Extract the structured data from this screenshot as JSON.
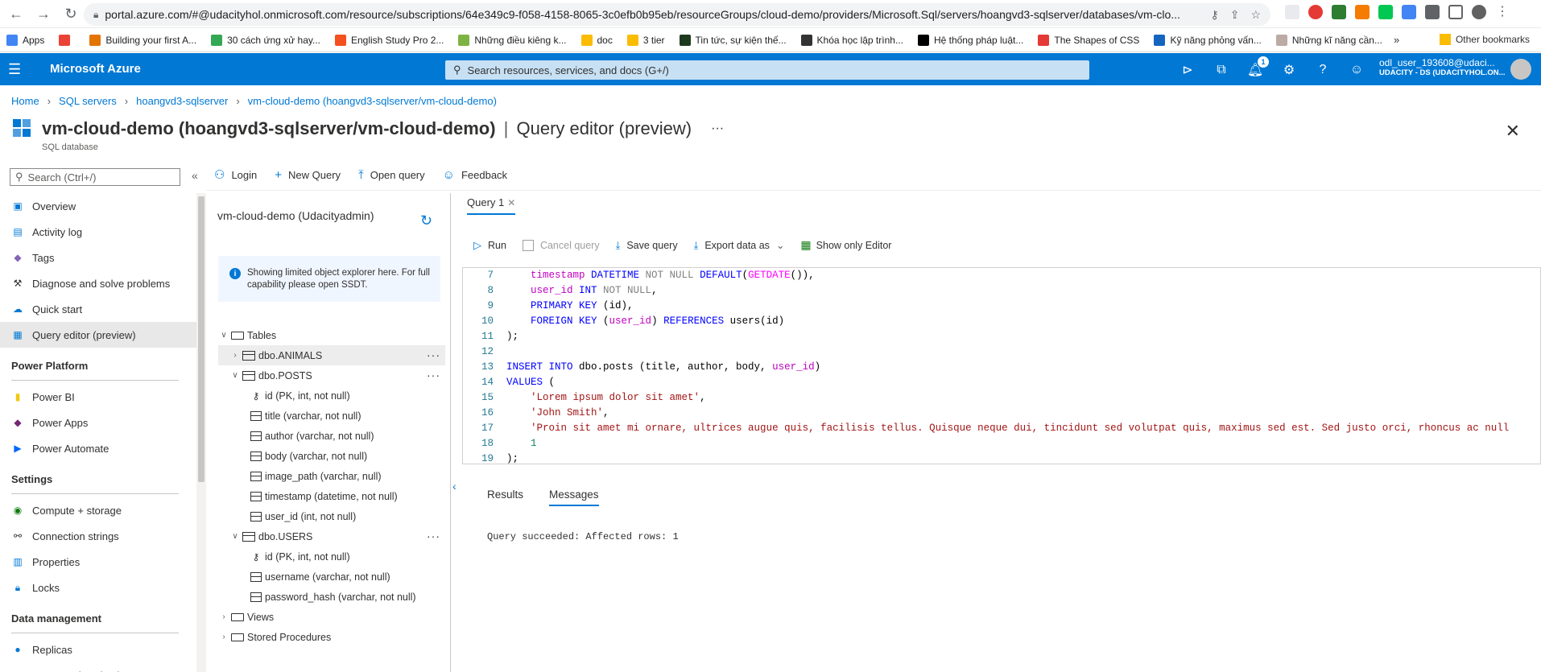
{
  "browser": {
    "url": "portal.azure.com/#@udacityhol.onmicrosoft.com/resource/subscriptions/64e349c9-f058-4158-8065-3c0efb0b95eb/resourceGroups/cloud-demo/providers/Microsoft.Sql/servers/hoangvd3-sqlserver/databases/vm-clo...",
    "bookmarks": [
      {
        "label": "Apps",
        "color": "#4285f4"
      },
      {
        "label": "",
        "color": "#ea4335"
      },
      {
        "label": "Building your first A...",
        "color": "#e37400"
      },
      {
        "label": "30 cách ứng xử hay...",
        "color": "#34a853"
      },
      {
        "label": "English Study Pro 2...",
        "color": "#f4511e"
      },
      {
        "label": "Những điều kiêng k...",
        "color": "#7cb342"
      },
      {
        "label": "doc",
        "color": "#fbbc04"
      },
      {
        "label": "3 tier",
        "color": "#fbbc04"
      },
      {
        "label": "Tin tức, sự kiện thế...",
        "color": "#1e3a1e"
      },
      {
        "label": "Khóa học lập trình...",
        "color": "#333333"
      },
      {
        "label": "Hệ thống pháp luật...",
        "color": "#000000"
      },
      {
        "label": "The Shapes of CSS",
        "color": "#e53935"
      },
      {
        "label": "Kỹ năng phỏng vấn...",
        "color": "#1565c0"
      },
      {
        "label": "Những kĩ năng cần...",
        "color": "#bcaaa4"
      }
    ],
    "more_chevron": "»",
    "other_bookmarks": "Other bookmarks"
  },
  "azure": {
    "brand": "Microsoft Azure",
    "search_placeholder": "Search resources, services, and docs (G+/)",
    "notification_count": "1",
    "user_name": "odl_user_193608@udaci...",
    "user_directory": "UDACITY - DS (UDACITYHOL.ON..."
  },
  "breadcrumb": [
    {
      "label": "Home"
    },
    {
      "label": "SQL servers"
    },
    {
      "label": "hoangvd3-sqlserver"
    },
    {
      "label": "vm-cloud-demo (hoangvd3-sqlserver/vm-cloud-demo)"
    }
  ],
  "page": {
    "title_bold": "vm-cloud-demo (hoangvd3-sqlserver/vm-cloud-demo)",
    "title_sep": "|",
    "title_rest": "Query editor (preview)",
    "subtitle": "SQL database",
    "more": "···",
    "close": "✕"
  },
  "left_nav": {
    "search_placeholder": "Search (Ctrl+/)",
    "collapse": "«",
    "items": [
      {
        "type": "item",
        "label": "Overview",
        "icon": "overview-icon",
        "color": "#0078d4"
      },
      {
        "type": "item",
        "label": "Activity log",
        "icon": "activity-log-icon",
        "color": "#0078d4"
      },
      {
        "type": "item",
        "label": "Tags",
        "icon": "tags-icon",
        "color": "#8764b8"
      },
      {
        "type": "item",
        "label": "Diagnose and solve problems",
        "icon": "wrench-icon",
        "color": "#323130"
      },
      {
        "type": "item",
        "label": "Quick start",
        "icon": "cloud-icon",
        "color": "#0078d4"
      },
      {
        "type": "item",
        "label": "Query editor (preview)",
        "icon": "query-editor-icon",
        "color": "#0078d4",
        "active": true
      },
      {
        "type": "section",
        "label": "Power Platform"
      },
      {
        "type": "item",
        "label": "Power BI",
        "icon": "power-bi-icon",
        "color": "#f2c811"
      },
      {
        "type": "item",
        "label": "Power Apps",
        "icon": "power-apps-icon",
        "color": "#742774"
      },
      {
        "type": "item",
        "label": "Power Automate",
        "icon": "power-automate-icon",
        "color": "#0066ff"
      },
      {
        "type": "section",
        "label": "Settings"
      },
      {
        "type": "item",
        "label": "Compute + storage",
        "icon": "compute-icon",
        "color": "#107c10"
      },
      {
        "type": "item",
        "label": "Connection strings",
        "icon": "connection-icon",
        "color": "#323130"
      },
      {
        "type": "item",
        "label": "Properties",
        "icon": "properties-icon",
        "color": "#0078d4"
      },
      {
        "type": "item",
        "label": "Locks",
        "icon": "lock-icon",
        "color": "#0078d4"
      },
      {
        "type": "section",
        "label": "Data management"
      },
      {
        "type": "item",
        "label": "Replicas",
        "icon": "replicas-icon",
        "color": "#0078d4"
      },
      {
        "type": "item",
        "label": "Sync to other databases",
        "icon": "sync-icon",
        "color": "#0078d4"
      }
    ]
  },
  "toolbar": {
    "login": "Login",
    "new_query": "New Query",
    "open_query": "Open query",
    "feedback": "Feedback"
  },
  "explorer": {
    "title": "vm-cloud-demo (Udacityadmin)",
    "info": "Showing limited object explorer here. For full capability please open SSDT.",
    "tree": [
      {
        "level": 0,
        "chev": "∨",
        "icon": "folder",
        "label": "Tables"
      },
      {
        "level": 1,
        "chev": "›",
        "icon": "table",
        "label": "dbo.ANIMALS",
        "dots": true,
        "hl": true
      },
      {
        "level": 1,
        "chev": "∨",
        "icon": "table",
        "label": "dbo.POSTS",
        "dots": true
      },
      {
        "level": 2,
        "chev": "",
        "icon": "key",
        "label": "id (PK, int, not null)"
      },
      {
        "level": 2,
        "chev": "",
        "icon": "col",
        "label": "title (varchar, not null)"
      },
      {
        "level": 2,
        "chev": "",
        "icon": "col",
        "label": "author (varchar, not null)"
      },
      {
        "level": 2,
        "chev": "",
        "icon": "col",
        "label": "body (varchar, not null)"
      },
      {
        "level": 2,
        "chev": "",
        "icon": "col",
        "label": "image_path (varchar, null)"
      },
      {
        "level": 2,
        "chev": "",
        "icon": "col",
        "label": "timestamp (datetime, not null)"
      },
      {
        "level": 2,
        "chev": "",
        "icon": "col",
        "label": "user_id (int, not null)"
      },
      {
        "level": 1,
        "chev": "∨",
        "icon": "table",
        "label": "dbo.USERS",
        "dots": true
      },
      {
        "level": 2,
        "chev": "",
        "icon": "key",
        "label": "id (PK, int, not null)"
      },
      {
        "level": 2,
        "chev": "",
        "icon": "col",
        "label": "username (varchar, not null)"
      },
      {
        "level": 2,
        "chev": "",
        "icon": "col",
        "label": "password_hash (varchar, not null)"
      },
      {
        "level": 0,
        "chev": "›",
        "icon": "folder",
        "label": "Views"
      },
      {
        "level": 0,
        "chev": "›",
        "icon": "folder",
        "label": "Stored Procedures"
      }
    ]
  },
  "editor": {
    "tab_label": "Query 1",
    "tab_close": "✕",
    "run": "Run",
    "cancel_query": "Cancel query",
    "save_query": "Save query",
    "export_data": "Export data as",
    "show_only_editor": "Show only Editor",
    "lines": [
      {
        "n": "7",
        "tokens": [
          [
            "    ",
            ""
          ],
          [
            "timestamp ",
            "mg"
          ],
          [
            "DATETIME ",
            "kw"
          ],
          [
            "NOT NULL ",
            "gy"
          ],
          [
            "DEFAULT",
            "kw"
          ],
          [
            "(",
            ""
          ],
          [
            "GETDATE",
            "fn"
          ],
          [
            "()),",
            ""
          ]
        ]
      },
      {
        "n": "8",
        "tokens": [
          [
            "    ",
            ""
          ],
          [
            "user_id ",
            "mg"
          ],
          [
            "INT ",
            "kw"
          ],
          [
            "NOT NULL",
            "gy"
          ],
          [
            ",",
            ""
          ]
        ]
      },
      {
        "n": "9",
        "tokens": [
          [
            "    ",
            ""
          ],
          [
            "PRIMARY KEY ",
            "kw"
          ],
          [
            "(id),",
            ""
          ]
        ]
      },
      {
        "n": "10",
        "tokens": [
          [
            "    ",
            ""
          ],
          [
            "FOREIGN KEY ",
            "kw"
          ],
          [
            "(",
            ""
          ],
          [
            "user_id",
            "mg"
          ],
          [
            ") ",
            ""
          ],
          [
            "REFERENCES ",
            "kw"
          ],
          [
            "users(id)",
            ""
          ]
        ]
      },
      {
        "n": "11",
        "tokens": [
          [
            ");",
            ""
          ]
        ]
      },
      {
        "n": "12",
        "tokens": [
          [
            "",
            ""
          ]
        ]
      },
      {
        "n": "13",
        "tokens": [
          [
            "INSERT INTO ",
            "kw"
          ],
          [
            "dbo.posts (title, author, body, ",
            ""
          ],
          [
            "user_id",
            "mg"
          ],
          [
            ")",
            ""
          ]
        ]
      },
      {
        "n": "14",
        "tokens": [
          [
            "VALUES ",
            "kw"
          ],
          [
            "(",
            ""
          ]
        ]
      },
      {
        "n": "15",
        "tokens": [
          [
            "    ",
            ""
          ],
          [
            "'Lorem ipsum dolor sit amet'",
            "str"
          ],
          [
            ",",
            ""
          ]
        ]
      },
      {
        "n": "16",
        "tokens": [
          [
            "    ",
            ""
          ],
          [
            "'John Smith'",
            "str"
          ],
          [
            ",",
            ""
          ]
        ]
      },
      {
        "n": "17",
        "tokens": [
          [
            "    ",
            ""
          ],
          [
            "'Proin sit amet mi ornare, ultrices augue quis, facilisis tellus. Quisque neque dui, tincidunt sed volutpat quis, maximus sed est. Sed justo orci, rhoncus ac null",
            "str"
          ]
        ]
      },
      {
        "n": "18",
        "tokens": [
          [
            "    ",
            ""
          ],
          [
            "1",
            "num"
          ]
        ]
      },
      {
        "n": "19",
        "tokens": [
          [
            ");",
            ""
          ]
        ]
      }
    ]
  },
  "results": {
    "tab_results": "Results",
    "tab_messages": "Messages",
    "message": "Query succeeded: Affected rows: 1"
  }
}
